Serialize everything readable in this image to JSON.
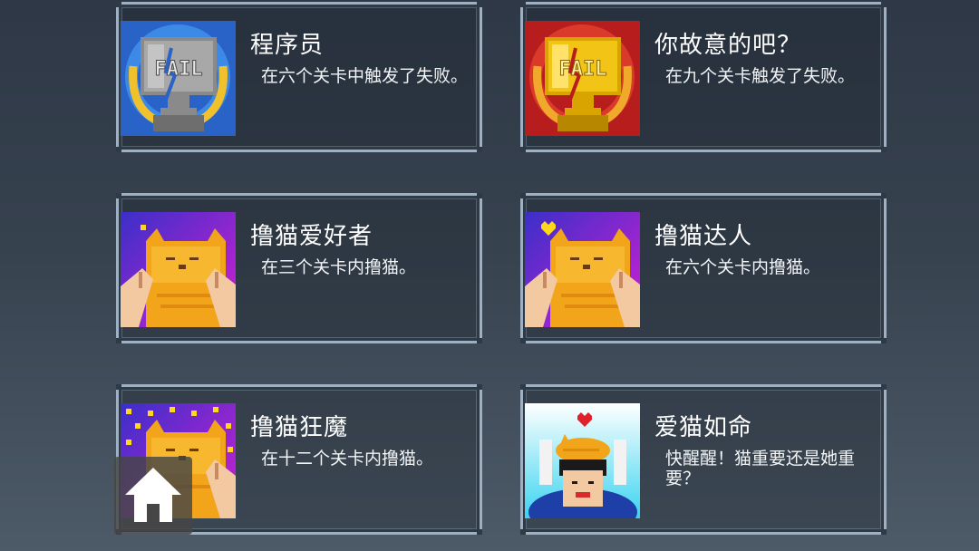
{
  "achievements": [
    {
      "title": "程序员",
      "description": "在六个关卡中触发了失败。",
      "icon": "silver-fail-trophy-icon"
    },
    {
      "title": "你故意的吧？",
      "description": "在九个关卡触发了失败。",
      "icon": "gold-fail-trophy-icon"
    },
    {
      "title": "撸猫爱好者",
      "description": "在三个关卡内撸猫。",
      "icon": "petting-cat-icon"
    },
    {
      "title": "撸猫达人",
      "description": "在六个关卡内撸猫。",
      "icon": "petting-cat-heart-icon"
    },
    {
      "title": "撸猫狂魔",
      "description": "在十二个关卡内撸猫。",
      "icon": "petting-cat-hearts-icon"
    },
    {
      "title": "爱猫如命",
      "description": "快醒醒！猫重要还是她重要？",
      "icon": "cat-on-head-icon"
    }
  ],
  "home_button": {
    "icon": "home-icon"
  },
  "colors": {
    "card_border": "#9fb0c2",
    "title_text": "#ffffff",
    "description_text": "#f2f4f6",
    "background_top": "#2e3846",
    "background_bottom": "#4d5a67"
  }
}
